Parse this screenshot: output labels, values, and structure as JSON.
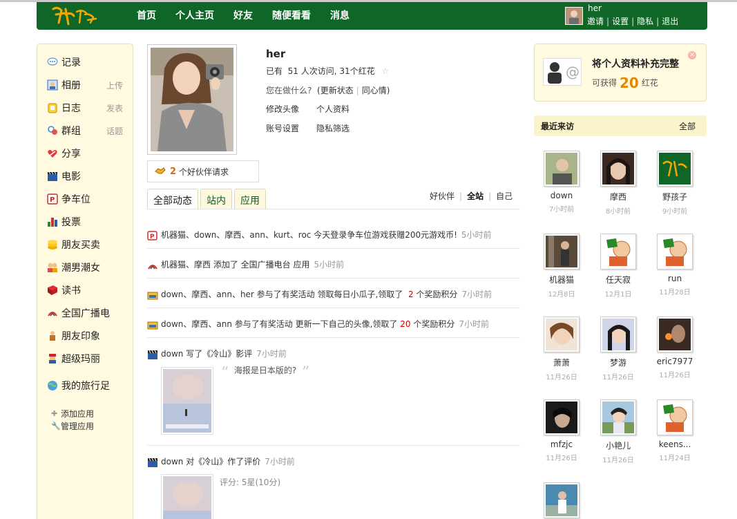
{
  "header": {
    "nav": [
      "首页",
      "个人主页",
      "好友",
      "随便看看",
      "消息"
    ],
    "user": "her",
    "links": [
      "邀请",
      "设置",
      "隐私",
      "退出"
    ]
  },
  "sidebar": {
    "items": [
      {
        "label": "记录",
        "sub": "",
        "icon": "speech-bubble-icon"
      },
      {
        "label": "相册",
        "sub": "上传",
        "icon": "photo-icon"
      },
      {
        "label": "日志",
        "sub": "发表",
        "icon": "notebook-icon"
      },
      {
        "label": "群组",
        "sub": "话题",
        "icon": "group-icon"
      },
      {
        "label": "分享",
        "sub": "",
        "icon": "heart-share-icon"
      },
      {
        "label": "电影",
        "sub": "",
        "icon": "clapboard-icon"
      },
      {
        "label": "争车位",
        "sub": "",
        "icon": "parking-icon"
      },
      {
        "label": "投票",
        "sub": "",
        "icon": "bar-chart-icon"
      },
      {
        "label": "朋友买卖",
        "sub": "",
        "icon": "coins-icon"
      },
      {
        "label": "潮男潮女",
        "sub": "",
        "icon": "couple-icon"
      },
      {
        "label": "读书",
        "sub": "",
        "icon": "book-icon"
      },
      {
        "label": "全国广播电",
        "sub": "",
        "icon": "radio-icon"
      },
      {
        "label": "朋友印象",
        "sub": "",
        "icon": "person-icon"
      },
      {
        "label": "超级玛丽",
        "sub": "",
        "icon": "mario-icon"
      },
      {
        "label": "我的旅行足",
        "sub": "",
        "icon": "globe-icon"
      }
    ],
    "add_app": "添加应用",
    "manage_app": "管理应用"
  },
  "profile": {
    "name": "her",
    "visits_prefix": "已有",
    "visits_count": "51",
    "visits_mid": "人次访问,",
    "red_flowers": "31个红花",
    "doing_prompt": "您在做什么?",
    "update_status": "(更新状态",
    "same_mood": "同心情)",
    "edit_avatar": "修改头像",
    "personal_info": "个人资料",
    "account_settings": "账号设置",
    "privacy_filter": "隐私筛选",
    "friend_req_count": "2",
    "friend_req_text": "个好伙伴请求"
  },
  "tabs": [
    "全部动态",
    "站内",
    "应用"
  ],
  "filters": [
    "好伙伴",
    "全站",
    "自己"
  ],
  "feeds": [
    {
      "icon": "parking-icon",
      "text": "机器猫、down、摩西、ann、kurt、roc 今天登录争车位游戏获赠200元游戏币!",
      "time": "5小时前"
    },
    {
      "icon": "radio-icon",
      "text": "机器猫、摩西 添加了 全国广播电台 应用",
      "time": "5小时前"
    },
    {
      "icon": "gift-icon",
      "text": "down、摩西、ann、her 参与了有奖活动 领取每日小瓜子,领取了",
      "num": "2",
      "text2": "个奖励积分",
      "time": "7小时前"
    },
    {
      "icon": "gift-icon",
      "text": "down、摩西、ann 参与了有奖活动 更新一下自己的头像,领取了",
      "num": "20",
      "text2": "个奖励积分",
      "time": "7小时前"
    },
    {
      "icon": "clapboard-icon",
      "text": "down 写了《冷山》影评",
      "time": "7小时前"
    },
    {
      "icon": "clapboard-icon",
      "text": "down 对《冷山》作了评价",
      "time": "7小时前"
    }
  ],
  "review_quote": "海报是日本版的?",
  "rating": "评分: 5星(10分)",
  "promo": {
    "title": "将个人资料补充完整",
    "sub_prefix": "可获得",
    "amount": "20",
    "sub_suffix": "红花"
  },
  "visitors": {
    "title": "最近来访",
    "all": "全部",
    "list": [
      {
        "name": "down",
        "date": "7小时前"
      },
      {
        "name": "摩西",
        "date": "8小时前"
      },
      {
        "name": "野孩子",
        "date": "9小时前"
      },
      {
        "name": "机器猫",
        "date": "12月8日"
      },
      {
        "name": "任天寂",
        "date": "12月1日"
      },
      {
        "name": "run",
        "date": "11月28日"
      },
      {
        "name": "萧萧",
        "date": "11月26日"
      },
      {
        "name": "梦游",
        "date": "11月26日"
      },
      {
        "name": "eric7977",
        "date": "11月26日"
      },
      {
        "name": "mfzjc",
        "date": "11月26日"
      },
      {
        "name": "小艳儿",
        "date": "11月26日"
      },
      {
        "name": "keens...",
        "date": "11月24日"
      }
    ]
  },
  "colors": {
    "brand_green": "#0f6626",
    "sidebar_bg": "#fffae0",
    "accent_orange": "#e08a00",
    "alert_red": "#d00000"
  }
}
